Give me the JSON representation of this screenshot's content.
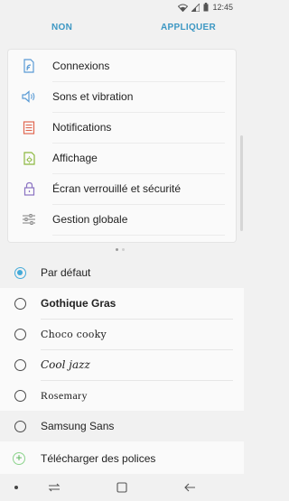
{
  "status_bar": {
    "time": "12:45",
    "icons": [
      "wifi-icon",
      "signal-icon",
      "battery-icon"
    ]
  },
  "action_bar": {
    "cancel_label": "NON",
    "apply_label": "APPLIQUER"
  },
  "preview": {
    "items": [
      {
        "label": "Connexions",
        "icon": "connections-icon"
      },
      {
        "label": "Sons et vibration",
        "icon": "speaker-icon"
      },
      {
        "label": "Notifications",
        "icon": "notifications-icon"
      },
      {
        "label": "Affichage",
        "icon": "display-icon"
      },
      {
        "label": "Écran verrouillé et sécurité",
        "icon": "lock-icon"
      },
      {
        "label": "Gestion globale",
        "icon": "sliders-icon"
      }
    ],
    "page_indicator": {
      "total": 2,
      "current": 1
    }
  },
  "fonts": {
    "items": [
      {
        "label": "Par défaut",
        "selected": true
      },
      {
        "label": "Gothique Gras",
        "selected": false
      },
      {
        "label": "Choco cooky",
        "selected": false
      },
      {
        "label": "Cool jazz",
        "selected": false
      },
      {
        "label": "Rosemary",
        "selected": false
      },
      {
        "label": "Samsung Sans",
        "selected": false
      }
    ],
    "download_label": "Télécharger des polices"
  },
  "colors": {
    "accent": "#3c97c3",
    "radio_selected": "#44aad9",
    "download_plus": "#4cae4c"
  },
  "nav_bar": {
    "buttons": [
      "recents-icon",
      "home-icon",
      "back-icon"
    ]
  }
}
